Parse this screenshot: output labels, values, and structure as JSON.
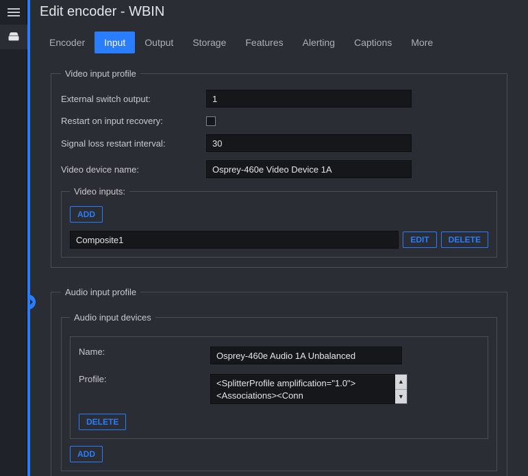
{
  "title": "Edit encoder - WBIN",
  "tabs": [
    "Encoder",
    "Input",
    "Output",
    "Storage",
    "Features",
    "Alerting",
    "Captions",
    "More"
  ],
  "activeTab": "Input",
  "video": {
    "groupTitle": "Video input profile",
    "externalSwitchLabel": "External switch output:",
    "externalSwitchValue": "1",
    "restartRecoveryLabel": "Restart on input recovery:",
    "restartRecoveryChecked": false,
    "signalLossLabel": "Signal loss restart interval:",
    "signalLossValue": "30",
    "deviceNameLabel": "Video device name:",
    "deviceNameValue": "Osprey-460e Video Device 1A",
    "inputsTitle": "Video inputs:",
    "addLabel": "ADD",
    "editLabel": "EDIT",
    "deleteLabel": "DELETE",
    "item0": "Composite1"
  },
  "audio": {
    "groupTitle": "Audio input profile",
    "devicesTitle": "Audio input devices",
    "nameLabel": "Name:",
    "nameValue": "Osprey-460e Audio 1A Unbalanced",
    "profileLabel": "Profile:",
    "profileValue": "<SplitterProfile amplification=\"1.0\"><Associations><Conn",
    "deleteLabel": "DELETE",
    "addLabel": "ADD"
  }
}
